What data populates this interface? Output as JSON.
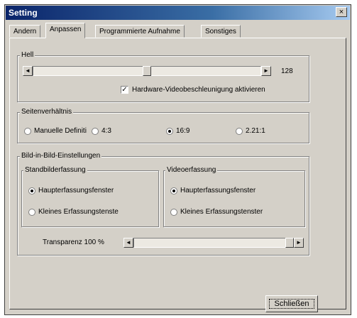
{
  "window": {
    "title": "Setting",
    "close_glyph": "×"
  },
  "tabs": [
    {
      "label": "Andern",
      "active": false
    },
    {
      "label": "Anpassen",
      "active": true
    },
    {
      "label": "Programmierte Aufnahme",
      "active": false
    },
    {
      "label": "Sonstiges",
      "active": false
    }
  ],
  "brightness": {
    "group_label": "Hell",
    "value_text": "128",
    "slider_fraction": 0.5,
    "hw_accel_label": "Hardware-Videobeschleunigung aktivieren",
    "hw_accel_checked": true
  },
  "aspect": {
    "group_label": "Seitenverhältnis",
    "options": [
      {
        "label": "Manuelle Definiti",
        "selected": false
      },
      {
        "label": "4:3",
        "selected": false
      },
      {
        "label": "16:9",
        "selected": true
      },
      {
        "label": "2.21:1",
        "selected": false
      }
    ]
  },
  "pip": {
    "group_label": "Bild-in-Bild-Einstellungen",
    "still": {
      "label": "Standbilderfassung",
      "options": [
        {
          "label": "Haupterfassungsfenster",
          "selected": true
        },
        {
          "label": "Kleines Erfassungstenste",
          "selected": false
        }
      ]
    },
    "video": {
      "label": "Videoerfassung",
      "options": [
        {
          "label": "Haupterfassungsfenster",
          "selected": true
        },
        {
          "label": "Kleines Erfassungstenster",
          "selected": false
        }
      ]
    },
    "transparency_label": "Transparenz 100 %",
    "transparency_fraction": 1.0
  },
  "buttons": {
    "close_label": "Schließen"
  },
  "scroll_glyphs": {
    "left": "◄",
    "right": "►"
  },
  "check_glyph": "✓"
}
